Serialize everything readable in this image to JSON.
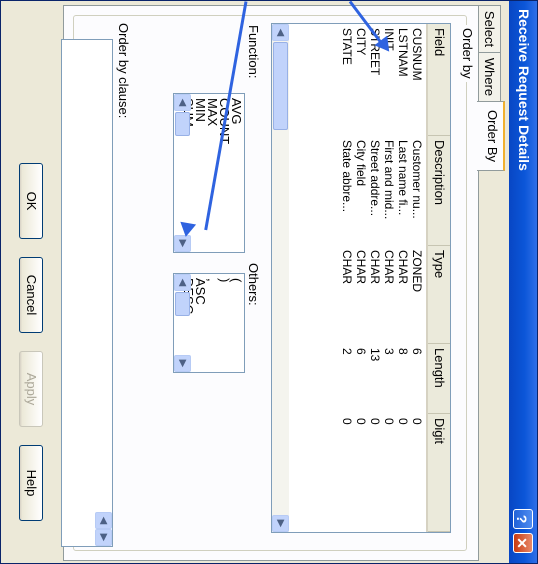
{
  "window": {
    "title": "Receive Request Details"
  },
  "titlebar": {
    "help_glyph": "?",
    "close_glyph": "✕",
    "help_icon": "help-icon",
    "close_icon": "close-icon"
  },
  "tabs": [
    {
      "label": "Select"
    },
    {
      "label": "Where"
    },
    {
      "label": "Order By"
    }
  ],
  "order_by": {
    "group_label": "Order by",
    "columns": [
      "Field",
      "Description",
      "Type",
      "Length",
      "Digit"
    ],
    "rows": [
      [
        "CUSNUM",
        "Customer nu...",
        "ZONED",
        "6",
        "0"
      ],
      [
        "LSTNAM",
        "Last name fi...",
        "CHAR",
        "8",
        "0"
      ],
      [
        "INIT",
        "First and mid...",
        "CHAR",
        "3",
        "0"
      ],
      [
        "STREET",
        "Street addre...",
        "CHAR",
        "13",
        "0"
      ],
      [
        "CITY",
        "City field",
        "CHAR",
        "6",
        "0"
      ],
      [
        "STATE",
        "State abbre...",
        "CHAR",
        "2",
        "0"
      ]
    ],
    "function_label": "Function:",
    "functions": [
      "AVG",
      "COUNT",
      "MAX",
      "MIN",
      "SUM"
    ],
    "others_label": "Others:",
    "others": [
      "(",
      ")",
      ",",
      "ASC",
      "DESC"
    ]
  },
  "clause": {
    "label": "Order by clause:",
    "value": ""
  },
  "buttons": {
    "ok": "OK",
    "cancel": "Cancel",
    "apply": "Apply",
    "help": "Help"
  },
  "colors": {
    "titlebar": "#0b56d8",
    "arrows": "#2f63e0",
    "tab_highlight": "#f0b030"
  }
}
